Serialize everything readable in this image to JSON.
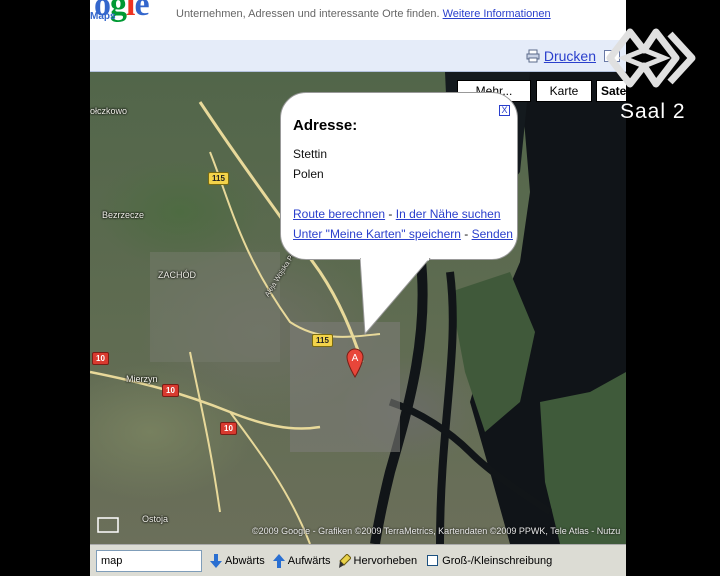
{
  "header": {
    "logo_text": "Google",
    "logo_sub": "Maps",
    "tagline": "Unternehmen, Adressen und interessante Orte finden.",
    "more_info_link": "Weitere Informationen",
    "print_link": "Drucken"
  },
  "map_controls": {
    "more_label": "Mehr...",
    "map_label": "Karte",
    "satellite_label": "Sate"
  },
  "map_labels": {
    "kolbaskowo": "ołczkowo",
    "bezrzecze": "Bezrzecze",
    "zachod": "ZACHÓD",
    "mierzyn": "Mierzyn",
    "ostoja": "Ostoja",
    "road_name": "Aleja Wojska Polskiego",
    "shield_115a": "115",
    "shield_115b": "115",
    "shield_10a": "10",
    "shield_10b": "10",
    "shield_10c": "10",
    "marker_letter": "A"
  },
  "info_window": {
    "title": "Adresse:",
    "line1": "Stettin",
    "line2": "Polen",
    "route_link": "Route berechnen",
    "separator1": " - ",
    "nearby_link": "In der Nähe suchen",
    "save_link": "Unter \"Meine Karten\" speichern",
    "separator2": " - ",
    "send_link": "Senden",
    "close_glyph": "X"
  },
  "copyright": "©2009 Google - Grafiken ©2009 TerraMetrics, Kartendaten ©2009 PPWK, Tele Atlas - Nutzu",
  "findbar": {
    "query": "map",
    "down_label": "Abwärts",
    "up_label": "Aufwärts",
    "highlight_label": "Hervorheben",
    "match_case_label": "Groß-/Kleinschreibung"
  },
  "broadcast": {
    "station_label": "Saal 2"
  },
  "colors": {
    "link_blue": "#2a3fcc",
    "water": "#101418",
    "road_yellow": "#f3d34a",
    "marker_red": "#e8463a"
  }
}
